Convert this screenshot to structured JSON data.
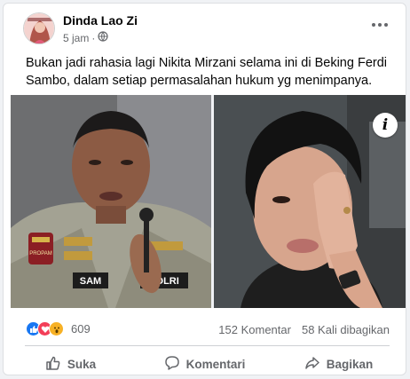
{
  "post": {
    "author": "Dinda Lao Zi",
    "time": "5 jam",
    "text": "Bukan jadi rahasia lagi Nikita Mirzani selama ini di Beking Ferdi Sambo, dalam setiap permasalahan hukum yg menimpanya.",
    "photo_left_badge": "POLRI",
    "photo_left_name": "SAM",
    "photo_left_shoulder": "PROPAM"
  },
  "stats": {
    "reaction_count": "609",
    "comments": "152 Komentar",
    "shares": "58 Kali dibagikan"
  },
  "actions": {
    "like": "Suka",
    "comment": "Komentari",
    "share": "Bagikan"
  },
  "icons": {
    "info": "i",
    "more": "more-options-icon",
    "privacy": "globe-icon"
  },
  "colors": {
    "like_blue": "#1877f2",
    "love_red": "#f33e58",
    "wow_yellow": "#f7b125",
    "secondary_text": "#65676b"
  }
}
